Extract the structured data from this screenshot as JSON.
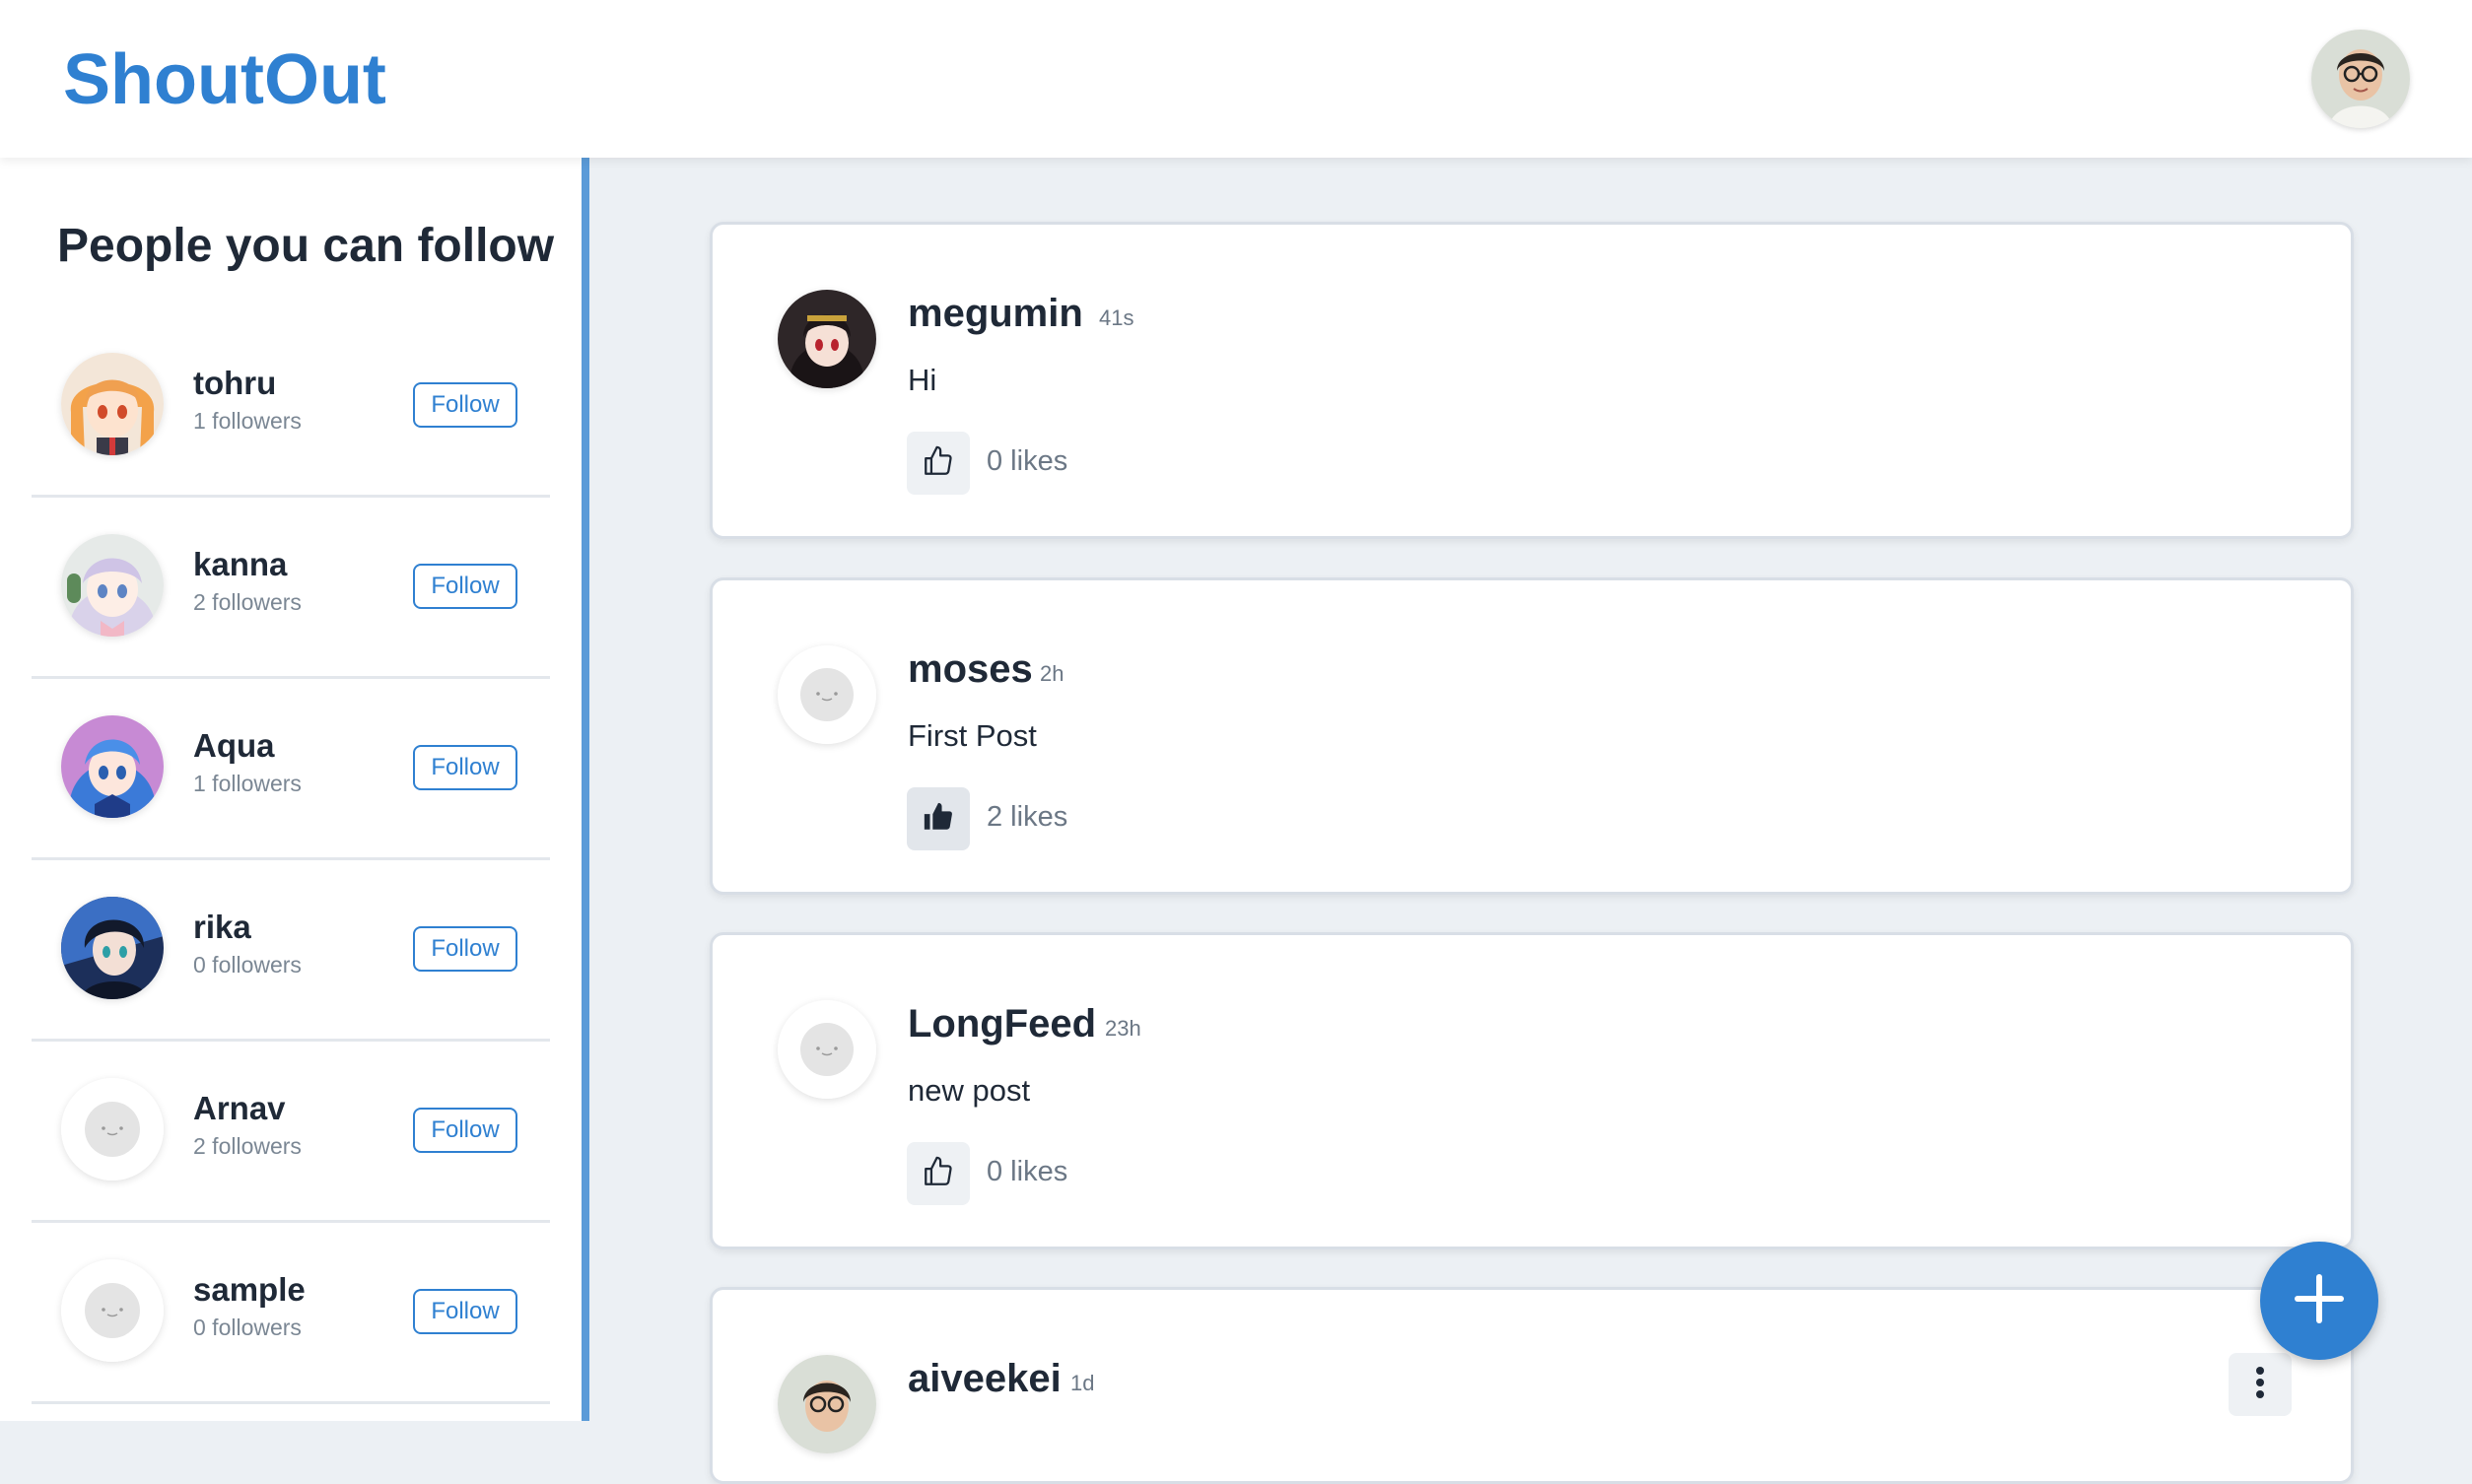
{
  "app": {
    "brand": "ShoutOut"
  },
  "sidebar": {
    "title": "People you can follow",
    "people": [
      {
        "name": "tohru",
        "followers": "1 followers",
        "follow_label": "Follow",
        "avatar": "anime-orange-hair"
      },
      {
        "name": "kanna",
        "followers": "2 followers",
        "follow_label": "Follow",
        "avatar": "anime-lavender-hair"
      },
      {
        "name": "Aqua",
        "followers": "1 followers",
        "follow_label": "Follow",
        "avatar": "anime-blue-hair"
      },
      {
        "name": "rika",
        "followers": "0 followers",
        "follow_label": "Follow",
        "avatar": "anime-dark-hair"
      },
      {
        "name": "Arnav",
        "followers": "2 followers",
        "follow_label": "Follow",
        "avatar": "default"
      },
      {
        "name": "sample",
        "followers": "0 followers",
        "follow_label": "Follow",
        "avatar": "default"
      }
    ]
  },
  "feed": {
    "posts": [
      {
        "user": "megumin",
        "time": "41s",
        "text": "Hi",
        "likes": "0 likes",
        "liked": false,
        "avatar": "anime-dark-hair-hat"
      },
      {
        "user": "moses",
        "time": "2h",
        "text": "First Post",
        "likes": "2 likes",
        "liked": true,
        "avatar": "default"
      },
      {
        "user": "LongFeed",
        "time": "23h",
        "text": "new post",
        "likes": "0 likes",
        "liked": false,
        "avatar": "default"
      },
      {
        "user": "aiveekei",
        "time": "1d",
        "text": "",
        "likes": "",
        "liked": false,
        "avatar": "user-photo"
      }
    ]
  },
  "colors": {
    "brand": "#2f80d1",
    "sidebar_border": "#5b9bd8",
    "background": "#ecf0f4"
  }
}
